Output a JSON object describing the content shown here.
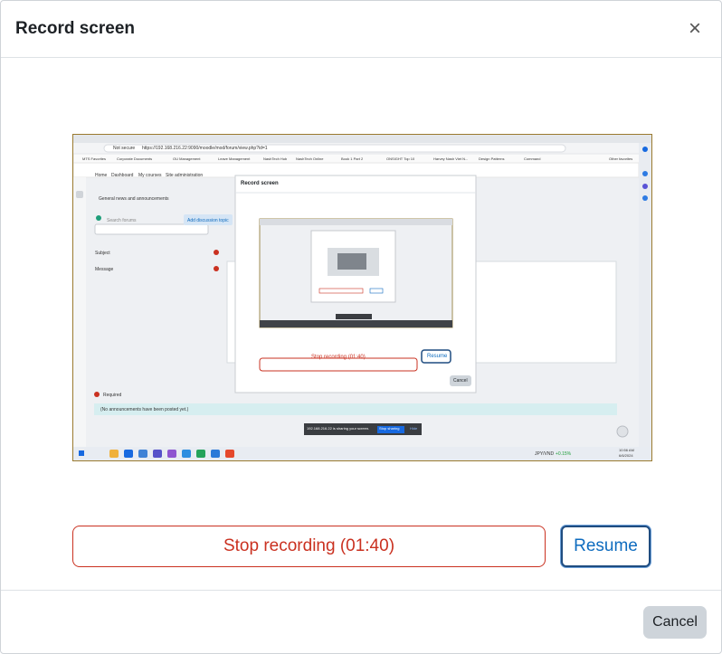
{
  "modal": {
    "title": "Record screen",
    "close_label": "×"
  },
  "preview": {
    "browser": {
      "address_prefix": "Not secure",
      "url": "https://192.168.216.22:9090/moodle/mod/forum/view.php?id=1",
      "bookmarks": [
        "MTS Favorites",
        "Corporate Documents",
        "OU Management",
        "Leave Management",
        "NashTech Hub",
        "NashTech Online",
        "Book 1 Part 2",
        "ONSIGHT Top 10",
        "Harvey Nash Viet N...",
        "Design Patterns",
        "Command",
        "Other favorites"
      ]
    },
    "moodle_nav": [
      "Home",
      "Dashboard",
      "My courses",
      "Site administration"
    ],
    "page_heading": "General news and announcements",
    "search_placeholder": "Search forums",
    "add_topic": "Add discussion topic",
    "subject_label": "Subject",
    "message_label": "Message",
    "required_label": "Required",
    "empty_notice": "(No announcements have been posted yet.)",
    "inner_modal": {
      "title": "Record screen",
      "stop": "Stop recording (01:40)",
      "resume": "Resume",
      "cancel": "Cancel"
    },
    "share_bar": {
      "text": "192.168.216.22 is sharing your screen.",
      "stop": "Stop sharing",
      "hide": "Hide"
    },
    "taskbar": {
      "lang": "JPY/VND",
      "change": "+0.15%",
      "time": "10:56 AM",
      "date": "6/6/2024"
    }
  },
  "controls": {
    "stop_label": "Stop recording (01:40)",
    "resume_label": "Resume"
  },
  "footer": {
    "cancel_label": "Cancel"
  }
}
